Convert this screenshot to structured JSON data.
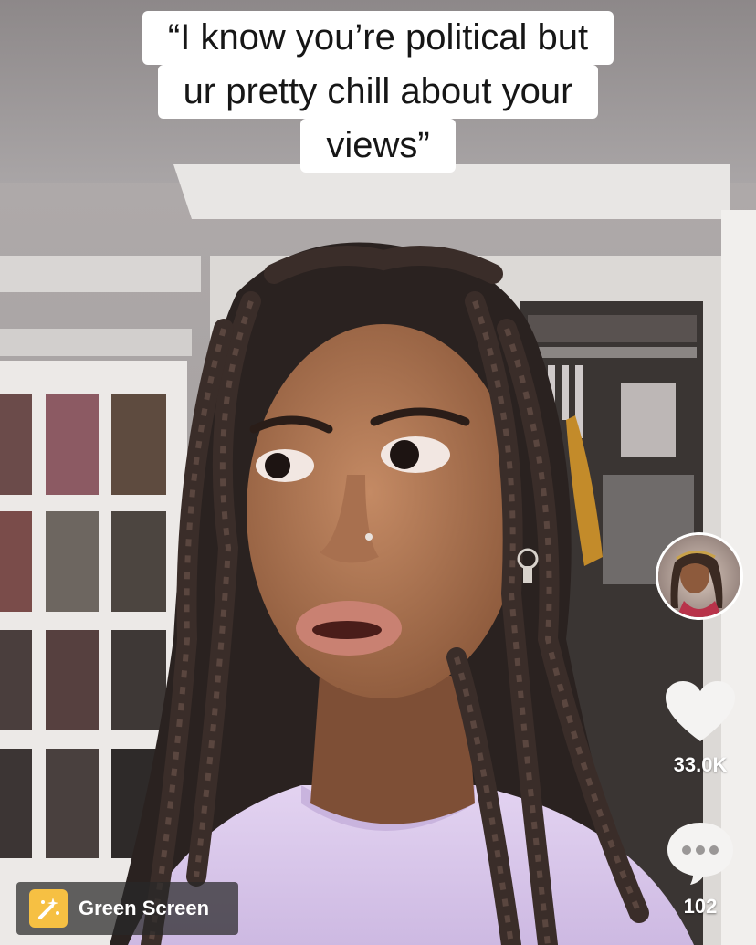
{
  "caption": {
    "lines": [
      "“I know you’re political but",
      "ur pretty chill about your",
      "views”"
    ]
  },
  "actions": {
    "like_count": "33.0K",
    "comment_count": "102",
    "avatar_icon": "creator-avatar",
    "like_icon": "heart-icon",
    "comment_icon": "comment-bubble-icon"
  },
  "effect": {
    "label": "Green Screen",
    "icon": "green-screen-effect-icon",
    "icon_color": "#f6c043"
  },
  "colors": {
    "caption_bg": "#ffffff",
    "caption_text": "#161616",
    "shirt": "#d9c7ec",
    "wall": "#b7b3b3"
  }
}
